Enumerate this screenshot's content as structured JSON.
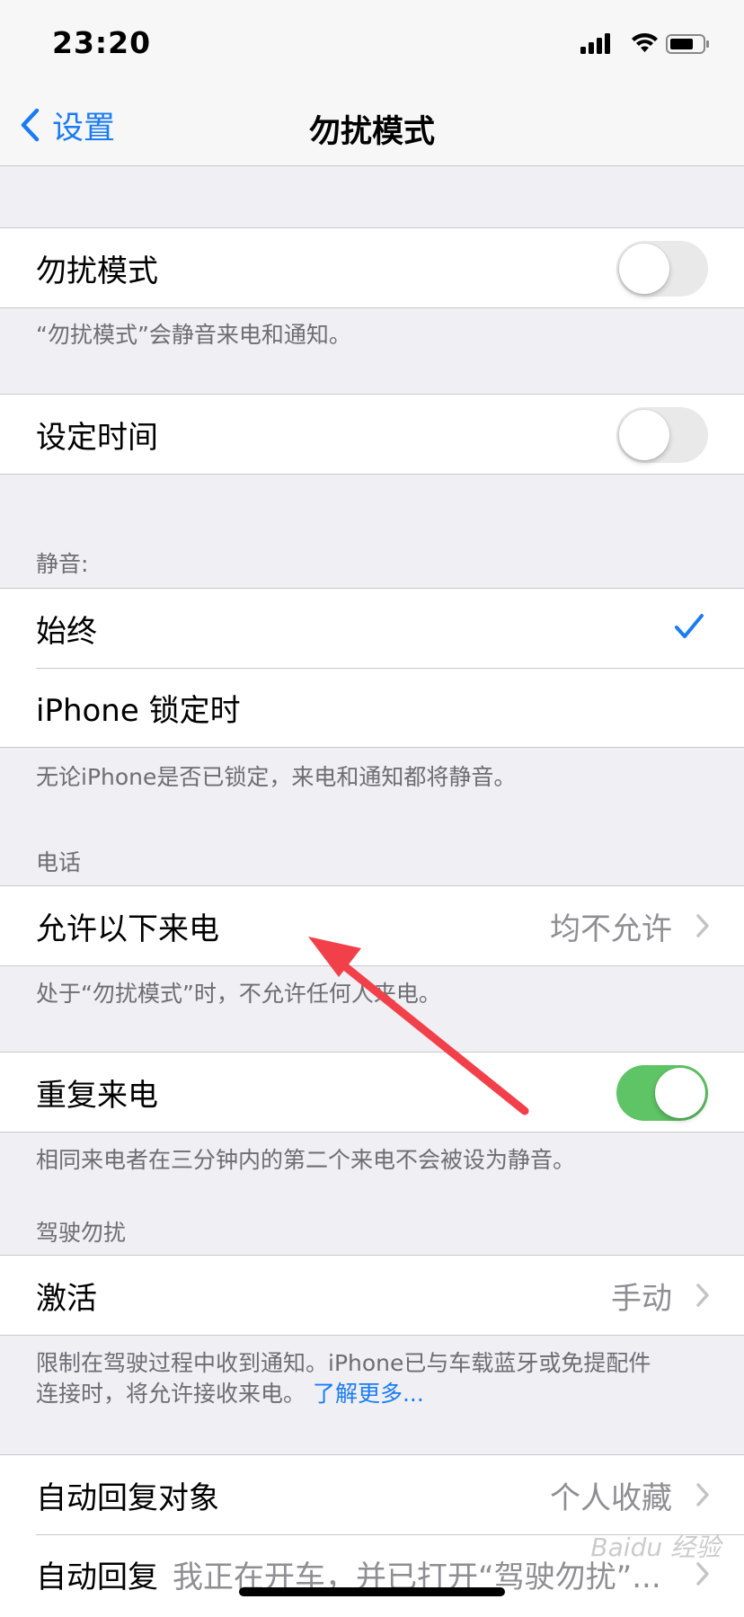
{
  "status_bar": {
    "time": "23:20"
  },
  "nav": {
    "back_label": "设置",
    "title": "勿扰模式"
  },
  "dnd": {
    "label": "勿扰模式",
    "toggle_on": false,
    "note": "“勿扰模式”会静音来电和通知。"
  },
  "scheduled": {
    "label": "设定时间",
    "toggle_on": false
  },
  "silence": {
    "header": "静音:",
    "always_label": "始终",
    "locked_label": "iPhone 锁定时",
    "note": "无论iPhone是否已锁定，来电和通知都将静音。"
  },
  "phone": {
    "header": "电话",
    "allow_calls_label": "允许以下来电",
    "allow_calls_value": "均不允许",
    "allow_calls_note": "处于“勿扰模式”时，不允许任何人来电。",
    "repeated_label": "重复来电",
    "repeated_toggle_on": true,
    "repeated_note": "相同来电者在三分钟内的第二个来电不会被设为静音。"
  },
  "driving": {
    "header": "驾驶勿扰",
    "activate_label": "激活",
    "activate_value": "手动",
    "note_line1": "限制在驾驶过程中收到通知。iPhone已与车载蓝牙或免提配件",
    "note_line2": "连接时，将允许接收来电。",
    "learn_more": "了解更多..."
  },
  "auto_reply": {
    "to_label": "自动回复对象",
    "to_value": "个人收藏",
    "reply_label": "自动回复",
    "reply_value": "我正在开车，并已打开“驾驶勿扰”..."
  },
  "watermark": "Baidu 经验",
  "colors": {
    "accent": "#1a7cf5",
    "toggle_on": "#5fc465",
    "arrow": "#f2404a"
  }
}
